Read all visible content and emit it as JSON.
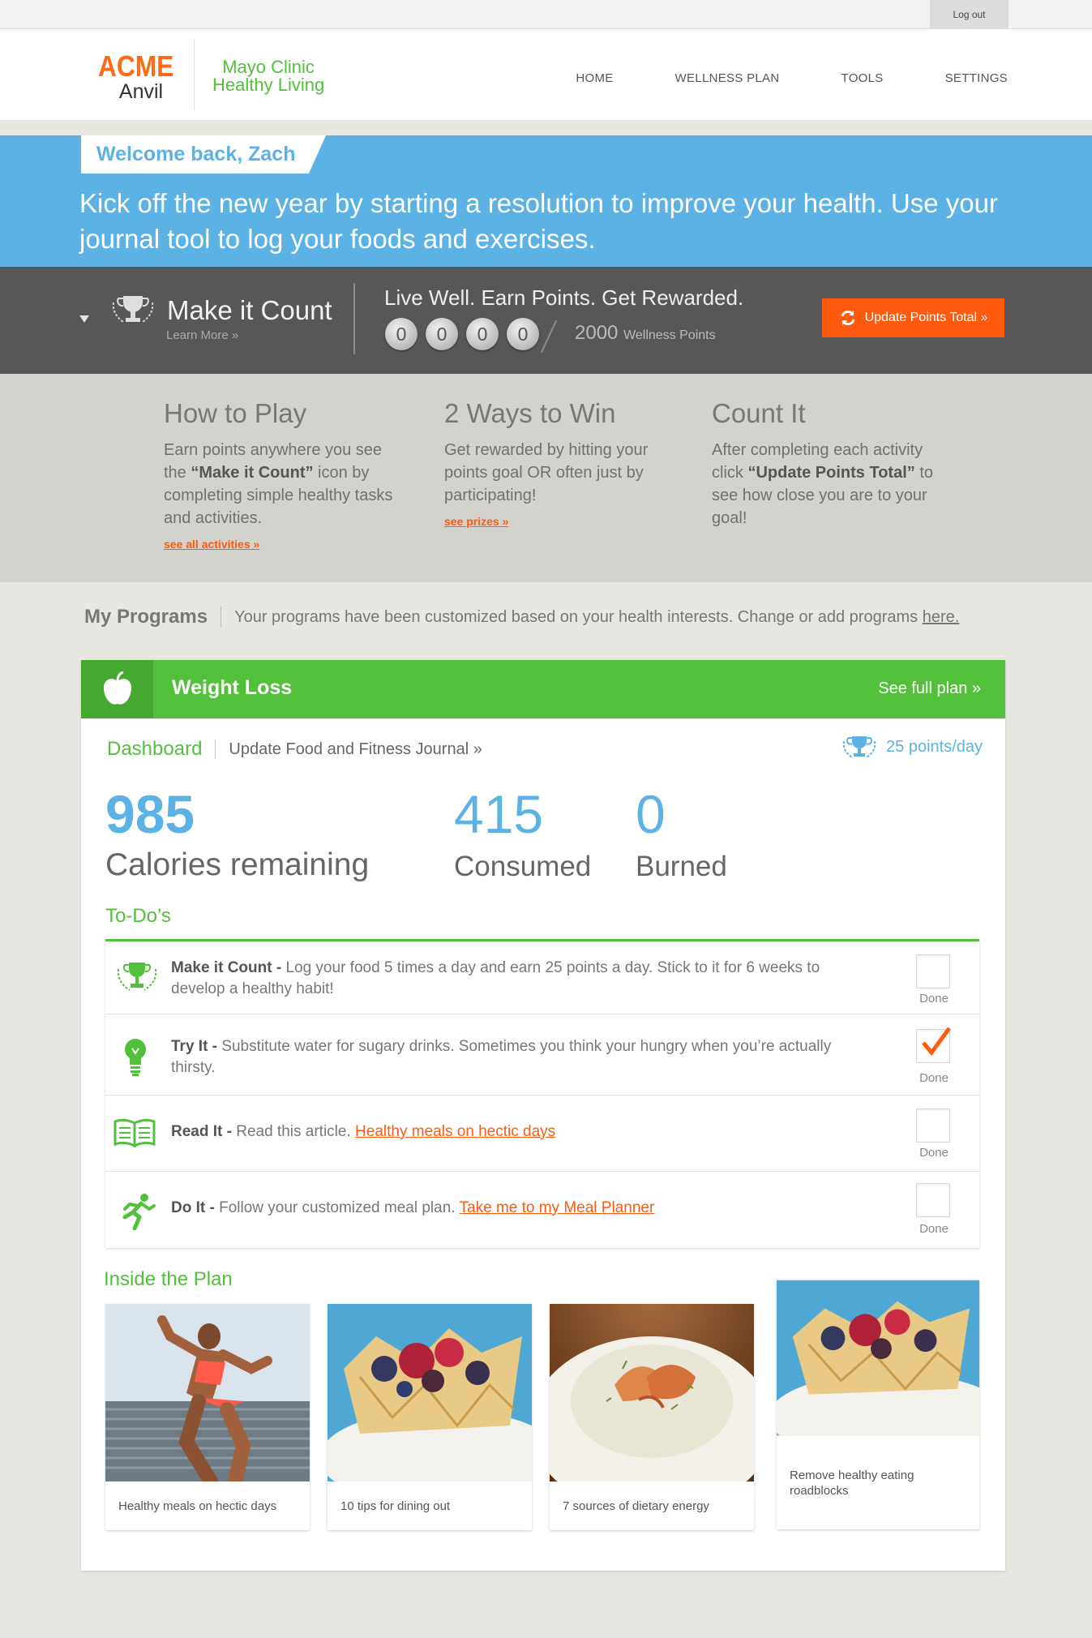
{
  "topbar": {
    "logout_label": "Log out"
  },
  "brand": {
    "name_top": "ACME",
    "name_bottom": "Anvil"
  },
  "partner": {
    "line1": "Mayo Clinic",
    "line2": "Healthy Living"
  },
  "nav": {
    "items": [
      "HOME",
      "WELLNESS PLAN",
      "TOOLS",
      "SETTINGS"
    ]
  },
  "welcome": {
    "greeting": "Welcome back, Zach",
    "message": "Kick off the new year by starting a resolution to improve your health. Use your journal tool to log your foods and exercises."
  },
  "points_bar": {
    "title": "Make it Count",
    "learn_more": "Learn More »",
    "tagline": "Live Well. Earn Points. Get Rewarded.",
    "digits": [
      "0",
      "0",
      "0",
      "0"
    ],
    "goal_value": "2000",
    "goal_unit": "Wellness Points",
    "button_label": "Update Points Total »"
  },
  "how_to": {
    "col1": {
      "heading": "How to Play",
      "pre": "Earn points anywhere you see the ",
      "bold": "“Make it Count”",
      "post": " icon by completing simple healthy tasks and activities.",
      "link": "see all activities »"
    },
    "col2": {
      "heading": "2 Ways to Win",
      "text": "Get rewarded by hitting your points goal OR often just by participating!",
      "link": "see prizes »"
    },
    "col3": {
      "heading": "Count It",
      "pre": "After completing each activity click ",
      "bold": "“Update Points Total”",
      "post": " to see how close you are to your goal!"
    }
  },
  "my_programs": {
    "title": "My Programs",
    "description": "Your programs have been customized based on your health interests. Change or add programs ",
    "link": "here."
  },
  "program": {
    "title": "Weight Loss",
    "see_plan": "See full plan »",
    "dashboard_label": "Dashboard",
    "journal_link": "Update Food and Fitness Journal »",
    "points_per_day": "25 points/day",
    "stats": {
      "remaining_value": "985",
      "remaining_label": "Calories remaining",
      "consumed_value": "415",
      "consumed_label": "Consumed",
      "burned_value": "0",
      "burned_label": "Burned"
    },
    "todos_title": "To-Do’s",
    "todos": [
      {
        "icon": "trophy-icon",
        "title": "Make it Count - ",
        "text": "Log your food 5 times a day and earn 25 points a day. Stick to it for 6 weeks to develop a healthy habit!",
        "link": "",
        "done_label": "Done",
        "checked": false
      },
      {
        "icon": "lightbulb-icon",
        "title": "Try It - ",
        "text": "Substitute water for sugary drinks. Sometimes you think your hungry when you’re actually thirsty.",
        "link": "",
        "done_label": "Done",
        "checked": true
      },
      {
        "icon": "book-icon",
        "title": "Read It - ",
        "text": "Read this article. ",
        "link": "Healthy meals on hectic days",
        "done_label": "Done",
        "checked": false
      },
      {
        "icon": "runner-icon",
        "title": "Do It - ",
        "text": "Follow your customized meal plan. ",
        "link": "Take me to my Meal Planner",
        "done_label": "Done",
        "checked": false
      }
    ],
    "inside_title": "Inside the Plan",
    "tiles": [
      {
        "caption": "Healthy meals on hectic days",
        "image": "athlete-photo"
      },
      {
        "caption": "10 tips for dining out",
        "image": "berry-tart-photo"
      },
      {
        "caption": "7 sources of dietary energy",
        "image": "shrimp-soup-photo"
      },
      {
        "caption": "Remove healthy eating roadblocks",
        "image": "berry-tart-photo"
      }
    ]
  },
  "colors": {
    "green": "#53c03c",
    "blue": "#5cb2e4",
    "orange": "#ff5a0e",
    "dark_gray": "#575757"
  }
}
